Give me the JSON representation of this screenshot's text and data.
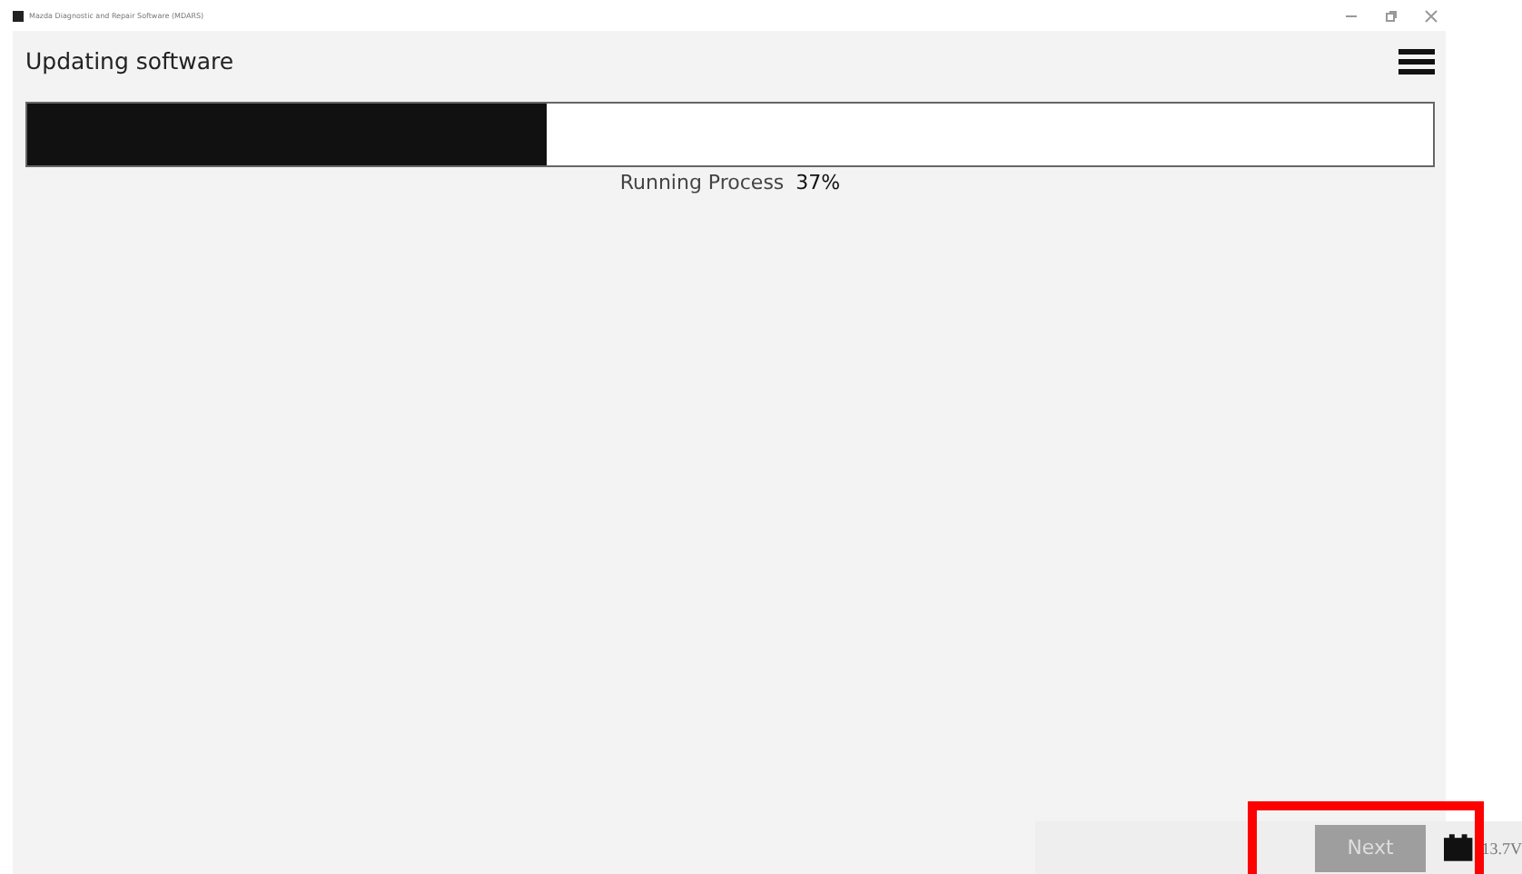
{
  "window": {
    "title": "Mazda Diagnostic and Repair Software (MDARS)"
  },
  "header": {
    "title": "Updating software"
  },
  "progress": {
    "level": 0.37,
    "label": "Running Process",
    "percent": "37%"
  },
  "footer": {
    "next_button": {
      "label": "Next",
      "disabled": true,
      "highlighted": true
    },
    "voltage": "13.7V"
  }
}
